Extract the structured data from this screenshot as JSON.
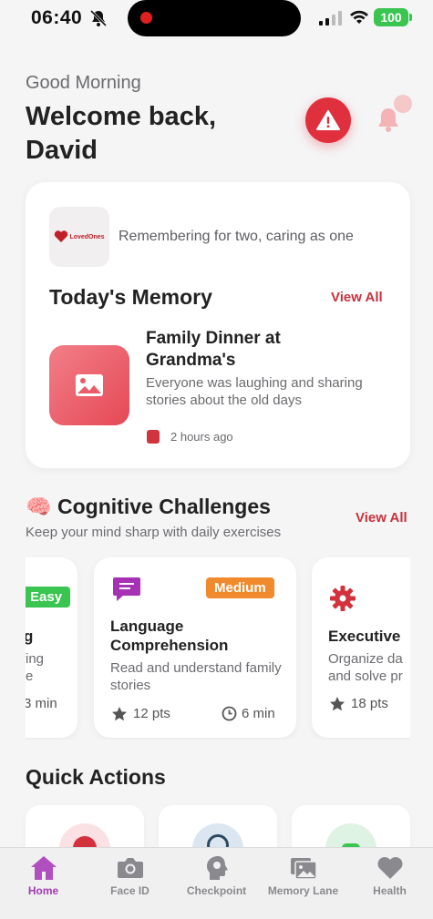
{
  "status_bar": {
    "time": "06:40",
    "battery": "100"
  },
  "header": {
    "greeting": "Good Morning",
    "welcome": "Welcome back, David"
  },
  "memory": {
    "logo_text": "LovedOnes",
    "tagline": "Remembering for two, caring as one",
    "section_title": "Today's Memory",
    "view_all": "View All",
    "item": {
      "title": "Family Dinner at Grandma's",
      "description": "Everyone was laughing and sharing stories about the old days",
      "time": "2 hours ago"
    }
  },
  "cognitive": {
    "title": "🧠 Cognitive Challenges",
    "subtitle": "Keep your mind sharp with daily exercises",
    "view_all": "View All",
    "cards": [
      {
        "badge": "Easy",
        "title_partial": "g",
        "desc_line1": "ing",
        "desc_line2": "e",
        "duration": "3 min"
      },
      {
        "badge": "Medium",
        "title": "Language Comprehension",
        "desc": "Read and understand family stories",
        "points": "12 pts",
        "duration": "6 min"
      },
      {
        "title": "Executive",
        "desc_line1": "Organize da",
        "desc_line2": "and solve pr",
        "points": "18 pts"
      }
    ]
  },
  "quick_actions": {
    "title": "Quick Actions"
  },
  "nav": {
    "items": [
      {
        "label": "Home"
      },
      {
        "label": "Face ID"
      },
      {
        "label": "Checkpoint"
      },
      {
        "label": "Memory Lane"
      },
      {
        "label": "Health"
      }
    ]
  },
  "colors": {
    "accent": "#c8323c",
    "emergency": "#e0303e",
    "nav_active": "#a23ab2",
    "easy_badge": "#3ac450",
    "medium_badge": "#f08a2c"
  }
}
